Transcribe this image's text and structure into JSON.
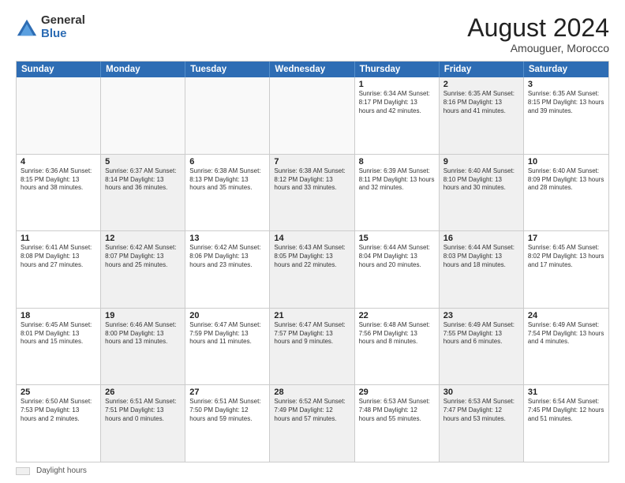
{
  "header": {
    "logo_general": "General",
    "logo_blue": "Blue",
    "title": "August 2024",
    "subtitle": "Amouguer, Morocco"
  },
  "days_of_week": [
    "Sunday",
    "Monday",
    "Tuesday",
    "Wednesday",
    "Thursday",
    "Friday",
    "Saturday"
  ],
  "weeks": [
    [
      {
        "day": "",
        "text": "",
        "empty": true
      },
      {
        "day": "",
        "text": "",
        "empty": true
      },
      {
        "day": "",
        "text": "",
        "empty": true
      },
      {
        "day": "",
        "text": "",
        "empty": true
      },
      {
        "day": "1",
        "text": "Sunrise: 6:34 AM\nSunset: 8:17 PM\nDaylight: 13 hours and 42 minutes.",
        "shaded": false
      },
      {
        "day": "2",
        "text": "Sunrise: 6:35 AM\nSunset: 8:16 PM\nDaylight: 13 hours and 41 minutes.",
        "shaded": true
      },
      {
        "day": "3",
        "text": "Sunrise: 6:35 AM\nSunset: 8:15 PM\nDaylight: 13 hours and 39 minutes.",
        "shaded": false
      }
    ],
    [
      {
        "day": "4",
        "text": "Sunrise: 6:36 AM\nSunset: 8:15 PM\nDaylight: 13 hours and 38 minutes.",
        "shaded": false
      },
      {
        "day": "5",
        "text": "Sunrise: 6:37 AM\nSunset: 8:14 PM\nDaylight: 13 hours and 36 minutes.",
        "shaded": true
      },
      {
        "day": "6",
        "text": "Sunrise: 6:38 AM\nSunset: 8:13 PM\nDaylight: 13 hours and 35 minutes.",
        "shaded": false
      },
      {
        "day": "7",
        "text": "Sunrise: 6:38 AM\nSunset: 8:12 PM\nDaylight: 13 hours and 33 minutes.",
        "shaded": true
      },
      {
        "day": "8",
        "text": "Sunrise: 6:39 AM\nSunset: 8:11 PM\nDaylight: 13 hours and 32 minutes.",
        "shaded": false
      },
      {
        "day": "9",
        "text": "Sunrise: 6:40 AM\nSunset: 8:10 PM\nDaylight: 13 hours and 30 minutes.",
        "shaded": true
      },
      {
        "day": "10",
        "text": "Sunrise: 6:40 AM\nSunset: 8:09 PM\nDaylight: 13 hours and 28 minutes.",
        "shaded": false
      }
    ],
    [
      {
        "day": "11",
        "text": "Sunrise: 6:41 AM\nSunset: 8:08 PM\nDaylight: 13 hours and 27 minutes.",
        "shaded": false
      },
      {
        "day": "12",
        "text": "Sunrise: 6:42 AM\nSunset: 8:07 PM\nDaylight: 13 hours and 25 minutes.",
        "shaded": true
      },
      {
        "day": "13",
        "text": "Sunrise: 6:42 AM\nSunset: 8:06 PM\nDaylight: 13 hours and 23 minutes.",
        "shaded": false
      },
      {
        "day": "14",
        "text": "Sunrise: 6:43 AM\nSunset: 8:05 PM\nDaylight: 13 hours and 22 minutes.",
        "shaded": true
      },
      {
        "day": "15",
        "text": "Sunrise: 6:44 AM\nSunset: 8:04 PM\nDaylight: 13 hours and 20 minutes.",
        "shaded": false
      },
      {
        "day": "16",
        "text": "Sunrise: 6:44 AM\nSunset: 8:03 PM\nDaylight: 13 hours and 18 minutes.",
        "shaded": true
      },
      {
        "day": "17",
        "text": "Sunrise: 6:45 AM\nSunset: 8:02 PM\nDaylight: 13 hours and 17 minutes.",
        "shaded": false
      }
    ],
    [
      {
        "day": "18",
        "text": "Sunrise: 6:45 AM\nSunset: 8:01 PM\nDaylight: 13 hours and 15 minutes.",
        "shaded": false
      },
      {
        "day": "19",
        "text": "Sunrise: 6:46 AM\nSunset: 8:00 PM\nDaylight: 13 hours and 13 minutes.",
        "shaded": true
      },
      {
        "day": "20",
        "text": "Sunrise: 6:47 AM\nSunset: 7:59 PM\nDaylight: 13 hours and 11 minutes.",
        "shaded": false
      },
      {
        "day": "21",
        "text": "Sunrise: 6:47 AM\nSunset: 7:57 PM\nDaylight: 13 hours and 9 minutes.",
        "shaded": true
      },
      {
        "day": "22",
        "text": "Sunrise: 6:48 AM\nSunset: 7:56 PM\nDaylight: 13 hours and 8 minutes.",
        "shaded": false
      },
      {
        "day": "23",
        "text": "Sunrise: 6:49 AM\nSunset: 7:55 PM\nDaylight: 13 hours and 6 minutes.",
        "shaded": true
      },
      {
        "day": "24",
        "text": "Sunrise: 6:49 AM\nSunset: 7:54 PM\nDaylight: 13 hours and 4 minutes.",
        "shaded": false
      }
    ],
    [
      {
        "day": "25",
        "text": "Sunrise: 6:50 AM\nSunset: 7:53 PM\nDaylight: 13 hours and 2 minutes.",
        "shaded": false
      },
      {
        "day": "26",
        "text": "Sunrise: 6:51 AM\nSunset: 7:51 PM\nDaylight: 13 hours and 0 minutes.",
        "shaded": true
      },
      {
        "day": "27",
        "text": "Sunrise: 6:51 AM\nSunset: 7:50 PM\nDaylight: 12 hours and 59 minutes.",
        "shaded": false
      },
      {
        "day": "28",
        "text": "Sunrise: 6:52 AM\nSunset: 7:49 PM\nDaylight: 12 hours and 57 minutes.",
        "shaded": true
      },
      {
        "day": "29",
        "text": "Sunrise: 6:53 AM\nSunset: 7:48 PM\nDaylight: 12 hours and 55 minutes.",
        "shaded": false
      },
      {
        "day": "30",
        "text": "Sunrise: 6:53 AM\nSunset: 7:47 PM\nDaylight: 12 hours and 53 minutes.",
        "shaded": true
      },
      {
        "day": "31",
        "text": "Sunrise: 6:54 AM\nSunset: 7:45 PM\nDaylight: 12 hours and 51 minutes.",
        "shaded": false
      }
    ]
  ],
  "footer": {
    "swatch_label": "Daylight hours"
  }
}
